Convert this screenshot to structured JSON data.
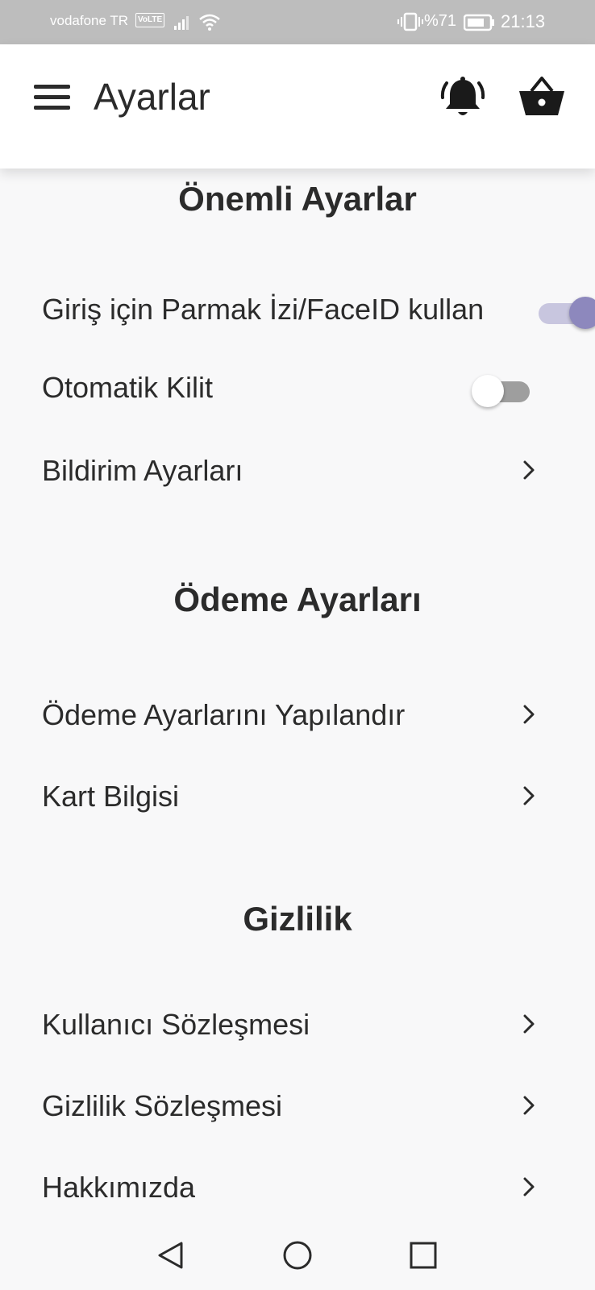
{
  "status_bar": {
    "carrier": "vodafone TR",
    "volte": "VoLTE",
    "battery_percent": "%71",
    "time": "21:13"
  },
  "app_bar": {
    "title": "Ayarlar",
    "icons": [
      "menu-icon",
      "bell-icon",
      "basket-icon"
    ]
  },
  "sections": {
    "important": {
      "title": "Önemli Ayarlar",
      "biometric_label": "Giriş için Parmak İzi/FaceID kullan",
      "biometric_enabled": true,
      "autolock_label": "Otomatik Kilit",
      "autolock_enabled": false,
      "notifications_label": "Bildirim Ayarları"
    },
    "payment": {
      "title": "Ödeme Ayarları",
      "configure_label": "Ödeme Ayarlarını Yapılandır",
      "card_label": "Kart Bilgisi"
    },
    "privacy": {
      "title": "Gizlilik",
      "user_agreement_label": "Kullanıcı Sözleşmesi",
      "privacy_agreement_label": "Gizlilik Sözleşmesi",
      "about_label": "Hakkımızda"
    }
  },
  "colors": {
    "toggle_on_knob": "#8d88bd",
    "toggle_on_track": "#c8c6df",
    "toggle_off_track": "#9e9e9e",
    "background": "#f8f8f9",
    "text": "#2b2b2b"
  }
}
